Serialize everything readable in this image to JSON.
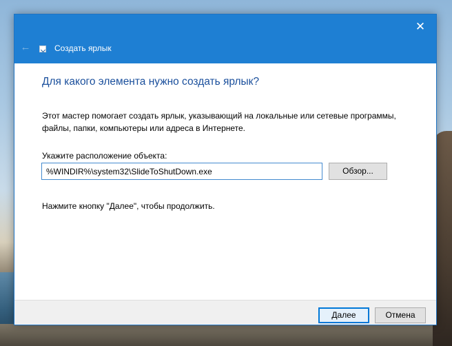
{
  "window": {
    "title": "Создать ярлык",
    "close_glyph": "✕",
    "back_glyph": "←"
  },
  "main": {
    "heading": "Для какого элемента нужно создать ярлык?",
    "description": "Этот мастер помогает создать ярлык, указывающий на локальные или сетевые программы, файлы, папки, компьютеры или адреса в Интернете.",
    "location_label": "Укажите расположение объекта:",
    "location_value": "%WINDIR%\\system32\\SlideToShutDown.exe",
    "browse_label": "Обзор...",
    "hint": "Нажмите кнопку \"Далее\", чтобы продолжить."
  },
  "footer": {
    "next_label": "Далее",
    "cancel_label": "Отмена"
  },
  "colors": {
    "titlebar": "#1e7fd3",
    "heading": "#1a4f9c",
    "focus_border": "#0078d7"
  }
}
